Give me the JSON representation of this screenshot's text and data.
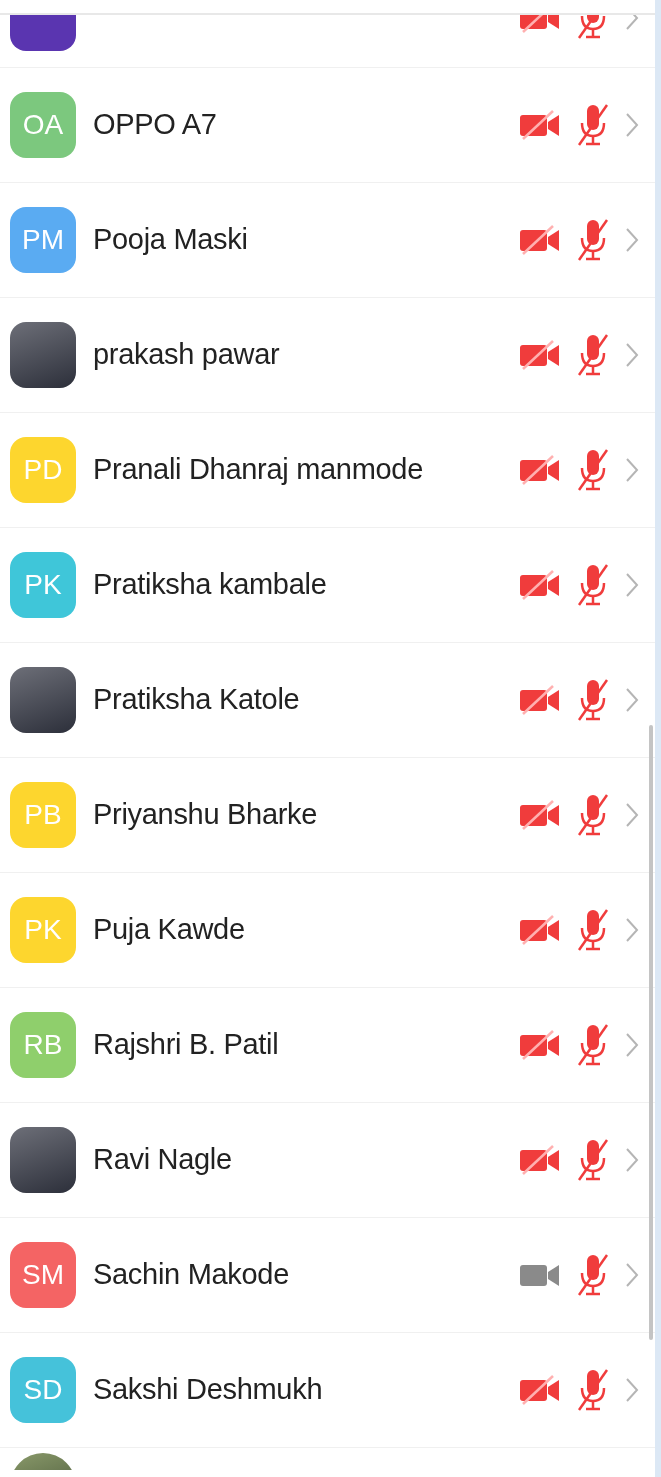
{
  "partial_top": {
    "color": "#5a35b0",
    "video_muted": true,
    "audio_muted": true
  },
  "participants": [
    {
      "kind": "initials",
      "initials": "OA",
      "name": "OPPO A7",
      "color": "#7cc87e",
      "video_muted": true,
      "audio_muted": true
    },
    {
      "kind": "initials",
      "initials": "PM",
      "name": "Pooja Maski",
      "color": "#5aabf2",
      "video_muted": true,
      "audio_muted": true
    },
    {
      "kind": "photo",
      "name": "prakash pawar",
      "video_muted": true,
      "audio_muted": true
    },
    {
      "kind": "initials",
      "initials": "PD",
      "name": "Pranali Dhanraj manmode",
      "color": "#fdd62e",
      "video_muted": true,
      "audio_muted": true
    },
    {
      "kind": "initials",
      "initials": "PK",
      "name": "Pratiksha kambale",
      "color": "#3fc6d9",
      "video_muted": true,
      "audio_muted": true
    },
    {
      "kind": "photo",
      "name": "Pratiksha Katole",
      "video_muted": true,
      "audio_muted": true
    },
    {
      "kind": "initials",
      "initials": "PB",
      "name": "Priyanshu Bharke",
      "color": "#fdd62e",
      "video_muted": true,
      "audio_muted": true
    },
    {
      "kind": "initials",
      "initials": "PK",
      "name": "Puja Kawde",
      "color": "#fdd62e",
      "video_muted": true,
      "audio_muted": true
    },
    {
      "kind": "initials",
      "initials": "RB",
      "name": "Rajshri B. Patil",
      "color": "#8fcf6c",
      "video_muted": true,
      "audio_muted": true
    },
    {
      "kind": "photo",
      "name": "Ravi Nagle",
      "video_muted": true,
      "audio_muted": true
    },
    {
      "kind": "initials",
      "initials": "SM",
      "name": "Sachin Makode",
      "color": "#f46464",
      "video_muted": false,
      "audio_muted": true
    },
    {
      "kind": "initials",
      "initials": "SD",
      "name": "Sakshi Deshmukh",
      "color": "#45c2da",
      "video_muted": true,
      "audio_muted": true
    }
  ],
  "partial_bottom": {
    "kind": "photo"
  }
}
